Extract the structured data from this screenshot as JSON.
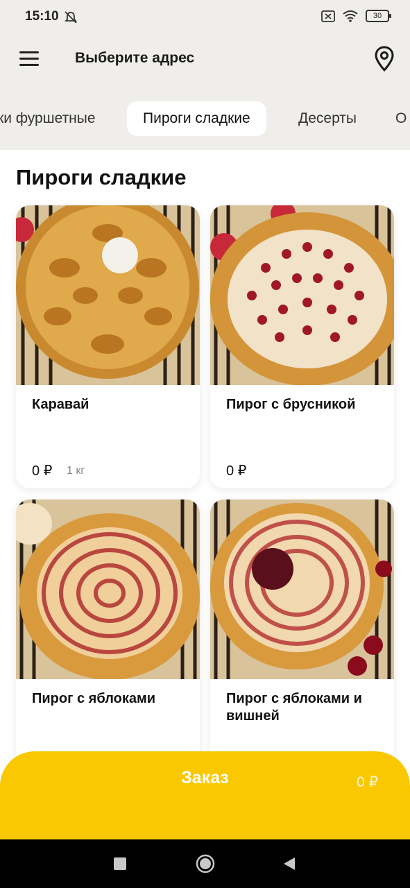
{
  "status_bar": {
    "time": "15:10",
    "battery": "30",
    "icons": [
      "dnd-off-icon",
      "sim-error-icon",
      "wifi-icon",
      "battery-icon"
    ]
  },
  "header": {
    "title": "Выберите адрес",
    "menu_icon": "hamburger-menu-icon",
    "location_icon": "map-pin-icon"
  },
  "categories": {
    "items": [
      "ки фуршетные",
      "Пироги сладкие",
      "Десерты",
      "О"
    ],
    "active": "Пироги сладкие"
  },
  "section": {
    "title": "Пироги сладкие"
  },
  "products": [
    {
      "name": "Каравай",
      "price": "0 ₽",
      "weight": "1 кг"
    },
    {
      "name": "Пирог с брусникой",
      "price": "0 ₽"
    },
    {
      "name": "Пирог с яблоками",
      "price": ""
    },
    {
      "name": "Пирог с яблоками и вишней",
      "price": ""
    }
  ],
  "order": {
    "label": "Заказ",
    "total": "0 ₽"
  },
  "nav": {
    "icons": [
      "recent-apps-icon",
      "home-icon",
      "back-icon"
    ]
  },
  "colors": {
    "accent": "#F9C800",
    "header_bg": "#F0EEEA",
    "card_bg": "#FFFFFF"
  }
}
